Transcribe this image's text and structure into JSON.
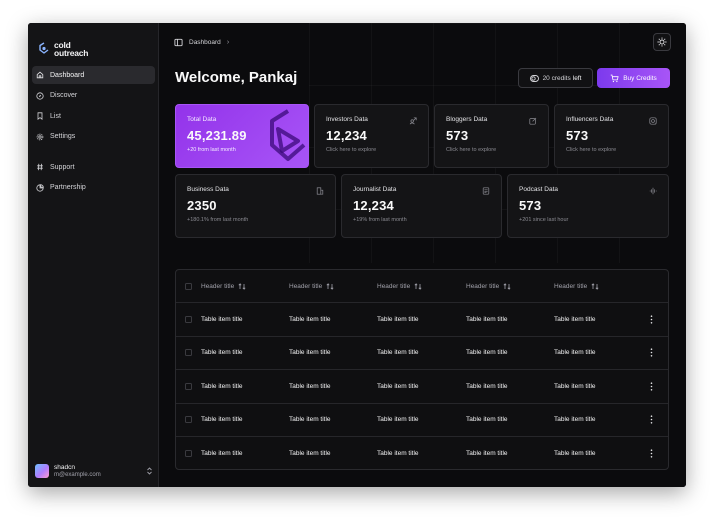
{
  "logo": {
    "line1": "cold",
    "line2": "outreach"
  },
  "sidebar": {
    "items": [
      {
        "label": "Dashboard",
        "icon": "home-icon",
        "active": true
      },
      {
        "label": "Discover",
        "icon": "compass-icon"
      },
      {
        "label": "List",
        "icon": "bookmark-icon"
      },
      {
        "label": "Settings",
        "icon": "gear-icon"
      }
    ],
    "items2": [
      {
        "label": "Support",
        "icon": "hash-icon"
      },
      {
        "label": "Partnership",
        "icon": "pie-chart-icon"
      }
    ],
    "user": {
      "name": "shadcn",
      "email": "m@example.com"
    }
  },
  "header": {
    "breadcrumb": "Dashboard",
    "separator": "›"
  },
  "welcome": "Welcome, Pankaj",
  "credits": {
    "count": "20 credits",
    "suffix": "left"
  },
  "buy_label": "Buy Credits",
  "cards": [
    {
      "title": "Total Data",
      "value": "45,231.89",
      "sub": "+20 from last month",
      "featured": true
    },
    {
      "title": "Investors Data",
      "value": "12,234",
      "sub": "Click here to explore",
      "icon": "person-arrow-icon"
    },
    {
      "title": "Bloggers Data",
      "value": "573",
      "sub": "Click here to explore",
      "icon": "edit-icon"
    },
    {
      "title": "Influencers Data",
      "value": "573",
      "sub": "Click here to explore",
      "icon": "camera-icon"
    },
    {
      "title": "Business Data",
      "value": "2350",
      "sub": "+180.1% from last month",
      "icon": "building-icon"
    },
    {
      "title": "Journalist Data",
      "value": "12,234",
      "sub": "+19% from last month",
      "icon": "newspaper-icon"
    },
    {
      "title": "Podcast Data",
      "value": "573",
      "sub": "+201 since last hour",
      "icon": "audio-wave-icon"
    }
  ],
  "table": {
    "headers": [
      "Header title",
      "Header title",
      "Header title",
      "Header title",
      "Header title"
    ],
    "rows": [
      [
        "Table item title",
        "Table item title",
        "Table item title",
        "Table item title",
        "Table item title"
      ],
      [
        "Table item title",
        "Table item title",
        "Table item title",
        "Table item title",
        "Table item title"
      ],
      [
        "Table item title",
        "Table item title",
        "Table item title",
        "Table item title",
        "Table item title"
      ],
      [
        "Table item title",
        "Table item title",
        "Table item title",
        "Table item title",
        "Table item title"
      ],
      [
        "Table item title",
        "Table item title",
        "Table item title",
        "Table item title",
        "Table item title"
      ]
    ]
  },
  "colors": {
    "accent": "#a855f7",
    "background": "#0b0b0d",
    "sidebar": "#141416"
  }
}
